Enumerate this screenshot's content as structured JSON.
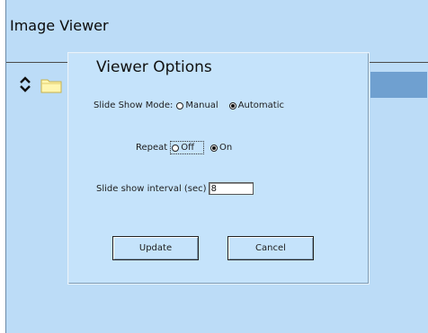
{
  "app": {
    "title": "Image Viewer"
  },
  "dialog": {
    "title": "Viewer Options",
    "slide_show_mode": {
      "label": "Slide Show Mode:",
      "options": [
        "Manual",
        "Automatic"
      ],
      "selected": "Automatic"
    },
    "repeat": {
      "label": "Repeat",
      "options": [
        "Off",
        "On"
      ],
      "selected": "On"
    },
    "interval": {
      "label": "Slide show interval (sec)",
      "value": "8"
    },
    "buttons": {
      "update": "Update",
      "cancel": "Cancel"
    }
  },
  "colors": {
    "background": "#bcdcf7",
    "dialog_background": "#c5e3fb",
    "selection": "#6fa0d0"
  },
  "icons": [
    "up-down-arrow-icon",
    "folder-icon"
  ]
}
